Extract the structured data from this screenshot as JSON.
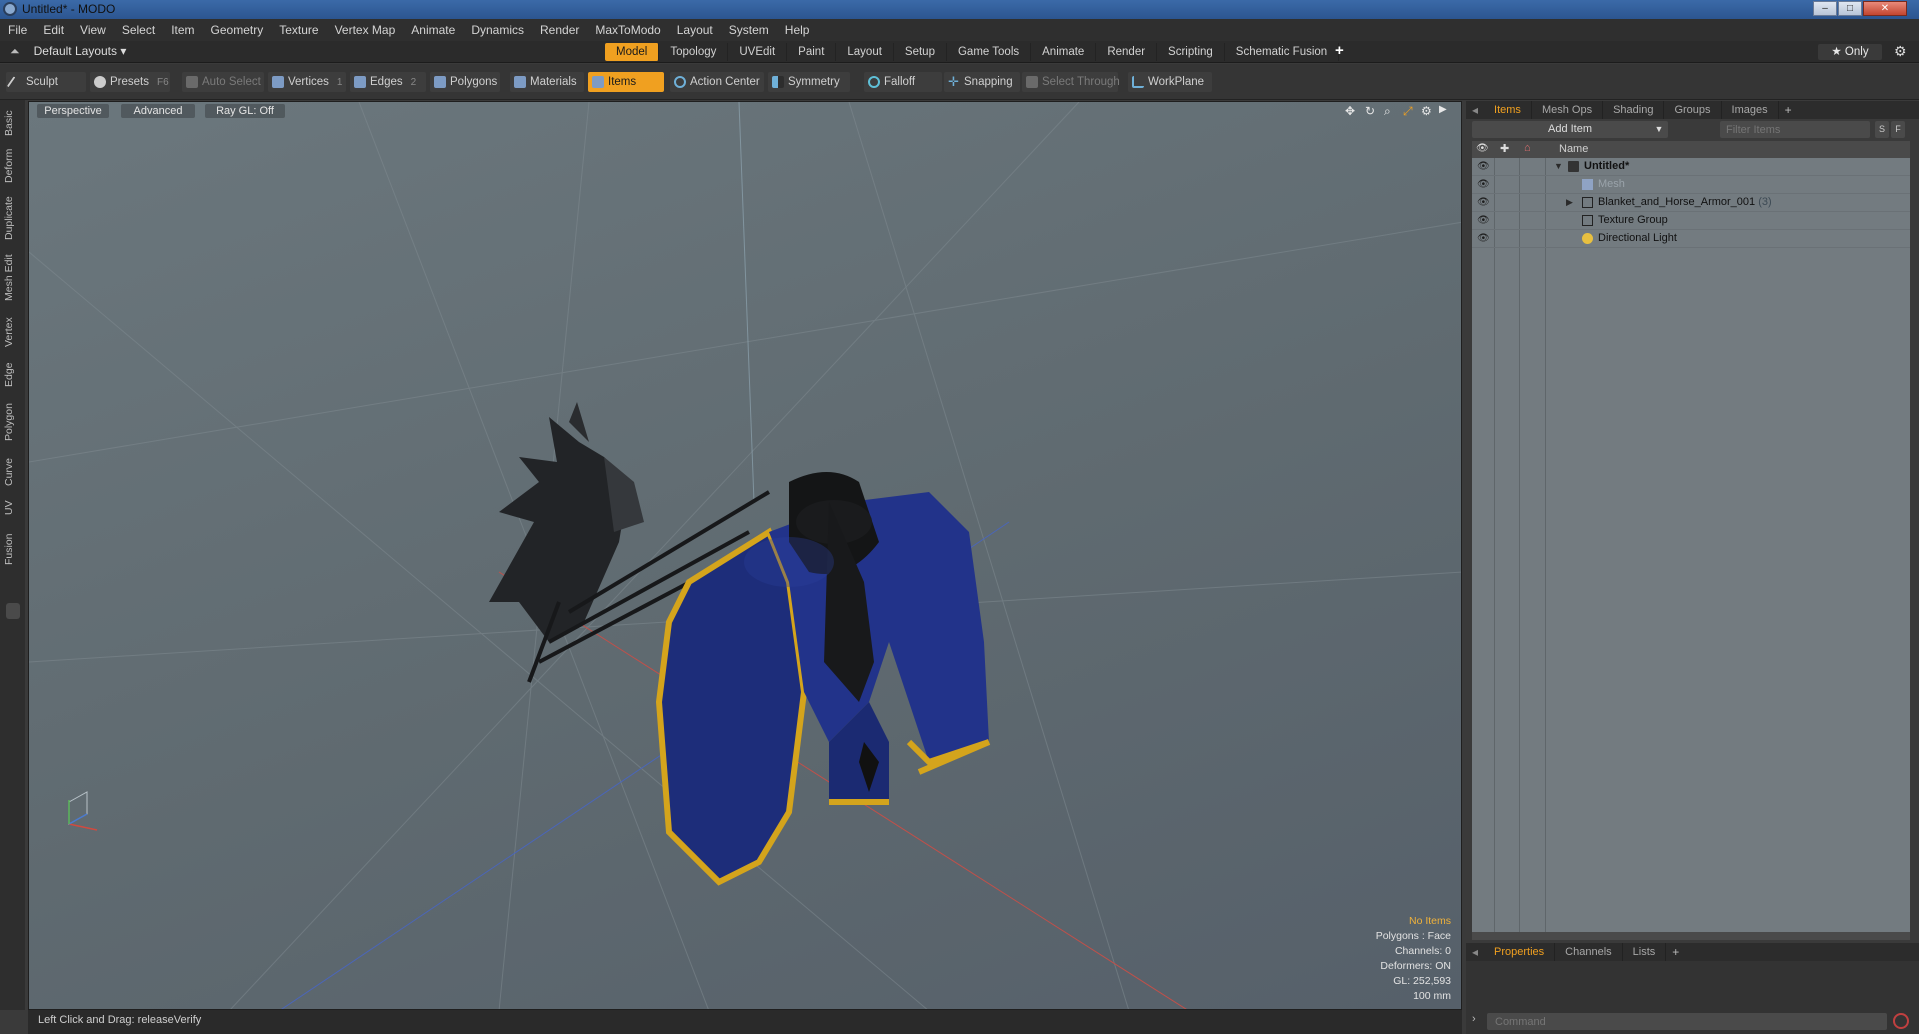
{
  "window": {
    "title": "Untitled* - MODO",
    "min": "–",
    "max": "□",
    "close": "✕"
  },
  "menu": [
    "File",
    "Edit",
    "View",
    "Select",
    "Item",
    "Geometry",
    "Texture",
    "Vertex Map",
    "Animate",
    "Dynamics",
    "Render",
    "MaxToModo",
    "Layout",
    "System",
    "Help"
  ],
  "layoutbar": {
    "dropdown": "Default Layouts ▾",
    "tabs": [
      "Model",
      "Topology",
      "UVEdit",
      "Paint",
      "Layout",
      "Setup",
      "Game Tools",
      "Animate",
      "Render",
      "Scripting",
      "Schematic Fusion"
    ],
    "active_tab": "Model",
    "add": "+",
    "only": "★ Only",
    "gear": "⚙"
  },
  "toolbar": {
    "sculpt": "Sculpt",
    "presets": "Presets",
    "presets_key": "F6",
    "auto_select": "Auto Select",
    "vertices": "Vertices",
    "vertices_key": "1",
    "edges": "Edges",
    "edges_key": "2",
    "polygons": "Polygons",
    "materials": "Materials",
    "items": "Items",
    "action_center": "Action Center",
    "symmetry": "Symmetry",
    "falloff": "Falloff",
    "snapping": "Snapping",
    "select_through": "Select Through",
    "workplane": "WorkPlane"
  },
  "sidetabs": [
    "Basic",
    "Deform",
    "Duplicate",
    "Mesh Edit",
    "Vertex",
    "Edge",
    "Polygon",
    "Curve",
    "UV",
    "Fusion"
  ],
  "viewport": {
    "perspective": "Perspective",
    "advanced": "Advanced",
    "raygl": "Ray GL: Off",
    "stats": {
      "no_items": "No Items",
      "polygons": "Polygons : Face",
      "channels": "Channels: 0",
      "deformers": "Deformers: ON",
      "gl": "GL: 252,593",
      "scale": "100 mm"
    }
  },
  "status": {
    "hint": "Left Click and Drag:  releaseVerify"
  },
  "panel": {
    "tabs": [
      "Items",
      "Mesh Ops",
      "Shading",
      "Groups",
      "Images"
    ],
    "plus": "+",
    "add_item": "Add Item",
    "filter_placeholder": "Filter Items",
    "s_btn": "S",
    "f_btn": "F",
    "col_name": "Name",
    "tree": [
      {
        "label": "Untitled*",
        "count": ""
      },
      {
        "label": "Mesh",
        "count": ""
      },
      {
        "label": "Blanket_and_Horse_Armor_001",
        "count": "(3)"
      },
      {
        "label": "Texture Group",
        "count": ""
      },
      {
        "label": "Directional Light",
        "count": ""
      }
    ],
    "bottom_tabs": [
      "Properties",
      "Channels",
      "Lists"
    ],
    "command_placeholder": "Command"
  },
  "colors": {
    "accent": "#f0a020",
    "title_bar": "#2c5590",
    "viewport_bg": "#646f75",
    "blanket": "#1d2d7a",
    "trim": "#d4a41c"
  }
}
